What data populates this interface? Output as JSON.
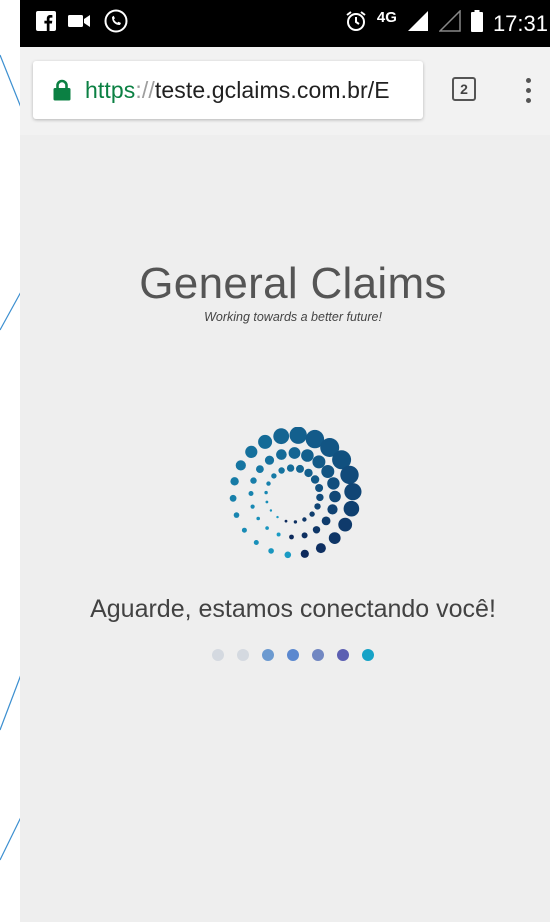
{
  "status_bar": {
    "time": "17:31",
    "network": "4G",
    "left_icons": [
      "facebook-icon",
      "video-icon",
      "call-icon"
    ],
    "right_icons": [
      "alarm-icon",
      "signal-icon",
      "signal-weak-icon",
      "battery-icon"
    ]
  },
  "browser": {
    "url_scheme": "https",
    "url_separator": "://",
    "url_host": "teste.gclaims.com.br/E",
    "tab_count": "2",
    "secure": true
  },
  "page": {
    "brand_title": "General Claims",
    "brand_tagline": "Working towards a better future!",
    "loading_message": "Aguarde, estamos conectando você!"
  },
  "colors": {
    "accent": "#1a9bc4",
    "navy": "#0d2a5c",
    "secure_green": "#0b8043",
    "page_bg": "#eeeeee",
    "progress_dots": [
      "#d4d9e0",
      "#d4d9e0",
      "#6c9ad0",
      "#5b88cf",
      "#7187c2",
      "#5c5fb2",
      "#17a3c7"
    ]
  }
}
